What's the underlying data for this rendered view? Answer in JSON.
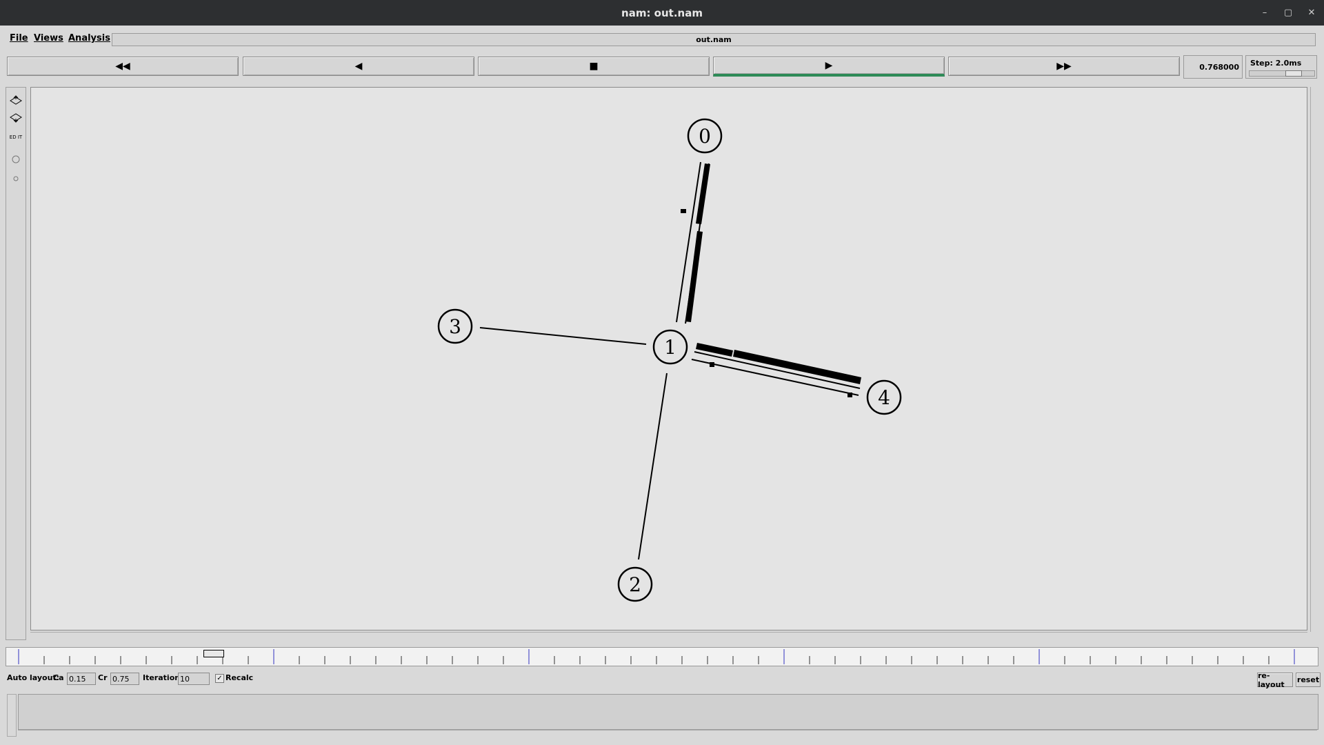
{
  "window": {
    "title": "nam: out.nam",
    "controls": [
      "–",
      "▢",
      "✕"
    ]
  },
  "menu": {
    "items": [
      "File",
      "Views",
      "Analysis"
    ]
  },
  "file_label": "out.nam",
  "playback": {
    "buttons": [
      "◀◀",
      "◀",
      "■",
      "▶",
      "▶▶"
    ],
    "active_index": 3,
    "active_color": "#2e8b57"
  },
  "time": "0.768000",
  "step": "Step: 2.0ms",
  "tools": [
    "zoom-in-icon",
    "zoom-out-icon",
    "edit-icon",
    "circle-icon",
    "small-circle-icon"
  ],
  "edit_label": "ED IT",
  "network": {
    "nodes": [
      {
        "id": "0",
        "label": "0"
      },
      {
        "id": "1",
        "label": "1"
      },
      {
        "id": "2",
        "label": "2"
      },
      {
        "id": "3",
        "label": "3"
      },
      {
        "id": "4",
        "label": "4"
      }
    ],
    "links": [
      {
        "from": "0",
        "to": "1",
        "duplex": true
      },
      {
        "from": "1",
        "to": "3",
        "duplex": false
      },
      {
        "from": "1",
        "to": "2",
        "duplex": false
      },
      {
        "from": "1",
        "to": "4",
        "duplex": true
      }
    ]
  },
  "autolayout": {
    "label": "Auto layout:",
    "ca_label": "Ca",
    "ca_value": "0.15",
    "cr_label": "Cr",
    "cr_value": "0.75",
    "iterations_label": "Iterations",
    "iterations_value": "10",
    "recalc_label": "Recalc",
    "recalc_checked": true
  },
  "buttons": {
    "relayout": "re-layout",
    "reset": "reset"
  }
}
